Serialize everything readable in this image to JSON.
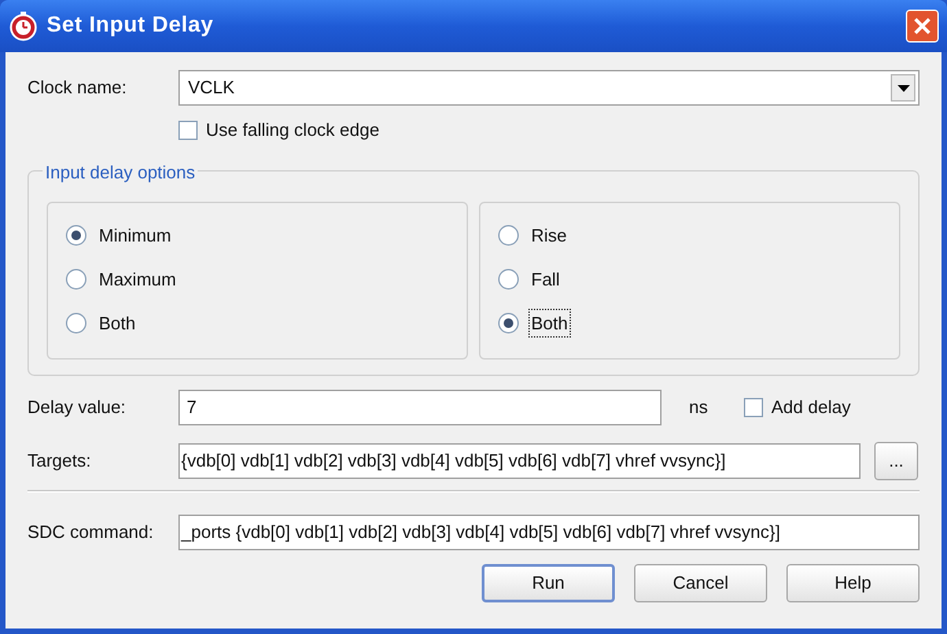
{
  "window": {
    "title": "Set Input Delay"
  },
  "clock": {
    "label": "Clock name:",
    "value": "VCLK"
  },
  "falling_edge": {
    "label": "Use falling clock edge",
    "checked": false
  },
  "options": {
    "title": "Input delay options",
    "groups": [
      [
        {
          "label": "Minimum",
          "selected": true,
          "focused": false
        },
        {
          "label": "Maximum",
          "selected": false,
          "focused": false
        },
        {
          "label": "Both",
          "selected": false,
          "focused": false
        }
      ],
      [
        {
          "label": "Rise",
          "selected": false,
          "focused": false
        },
        {
          "label": "Fall",
          "selected": false,
          "focused": false
        },
        {
          "label": "Both",
          "selected": true,
          "focused": true
        }
      ]
    ]
  },
  "delay": {
    "label": "Delay value:",
    "value": "7",
    "unit": "ns"
  },
  "add_delay": {
    "label": "Add delay",
    "checked": false
  },
  "targets": {
    "label": "Targets:",
    "value": "{vdb[0] vdb[1] vdb[2] vdb[3] vdb[4] vdb[5] vdb[6] vdb[7] vhref vvsync}]",
    "browse": "..."
  },
  "sdc": {
    "label": "SDC command:",
    "value": "_ports {vdb[0] vdb[1] vdb[2] vdb[3] vdb[4] vdb[5] vdb[6] vdb[7] vhref vvsync}]"
  },
  "buttons": [
    {
      "label": "Run",
      "default": true
    },
    {
      "label": "Cancel",
      "default": false
    },
    {
      "label": "Help",
      "default": false
    }
  ]
}
